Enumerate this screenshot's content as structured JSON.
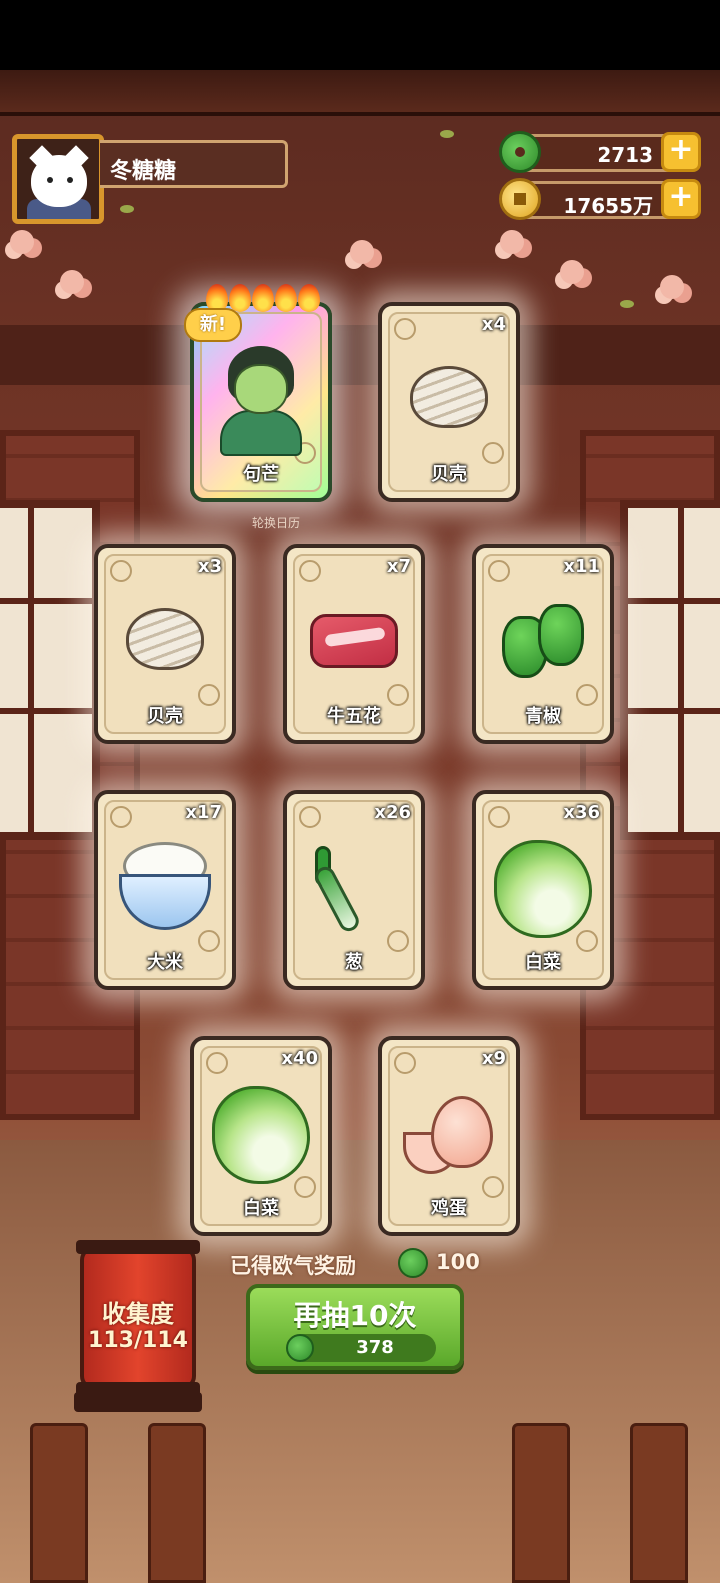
{
  "profile": {
    "name": "冬糖糖"
  },
  "currency": [
    {
      "name": "jade",
      "value": "2713"
    },
    {
      "name": "coin",
      "value": "17655万"
    }
  ],
  "cards": [
    {
      "label": "句芒",
      "count": "",
      "illustration": "character",
      "badge": "新!",
      "flames": 5,
      "caption": "轮换日历"
    },
    {
      "label": "贝壳",
      "count": "x4",
      "illustration": "shell"
    },
    {
      "label": "贝壳",
      "count": "x3",
      "illustration": "shell"
    },
    {
      "label": "牛五花",
      "count": "x7",
      "illustration": "meat"
    },
    {
      "label": "青椒",
      "count": "x11",
      "illustration": "pepper"
    },
    {
      "label": "大米",
      "count": "x17",
      "illustration": "rice"
    },
    {
      "label": "葱",
      "count": "x26",
      "illustration": "scallion"
    },
    {
      "label": "白菜",
      "count": "x36",
      "illustration": "cabbage"
    },
    {
      "label": "白菜",
      "count": "x40",
      "illustration": "cabbage"
    },
    {
      "label": "鸡蛋",
      "count": "x9",
      "illustration": "egg"
    }
  ],
  "reward": {
    "text": "已得欧气奖励",
    "value": "100"
  },
  "draw_button": {
    "label": "再抽10次",
    "cost": "378"
  },
  "collection": {
    "label": "收集度",
    "progress": "113/114"
  },
  "colors": {
    "accent_green": "#5aa82a",
    "gold": "#f6c030",
    "lantern_red": "#e2442c"
  }
}
